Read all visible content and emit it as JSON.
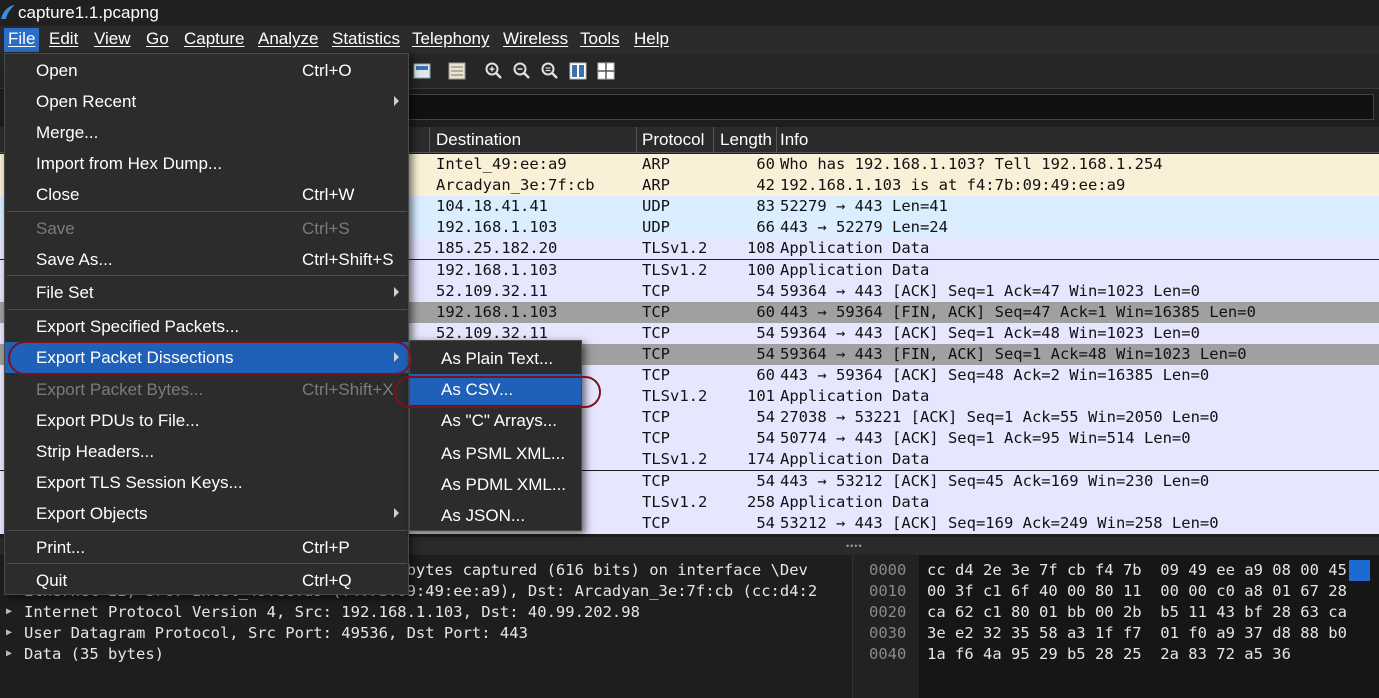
{
  "window": {
    "title": "capture1.1.pcapng"
  },
  "menubar": [
    {
      "label": "File"
    },
    {
      "label": "Edit"
    },
    {
      "label": "View"
    },
    {
      "label": "Go"
    },
    {
      "label": "Capture"
    },
    {
      "label": "Analyze"
    },
    {
      "label": "Statistics"
    },
    {
      "label": "Telephony"
    },
    {
      "label": "Wireless"
    },
    {
      "label": "Tools"
    },
    {
      "label": "Help"
    }
  ],
  "toolbar_icons": [
    "colorize-icon",
    "auto-scroll-icon",
    "zoom-in-icon",
    "zoom-out-icon",
    "zoom-reset-icon",
    "resize-columns-icon",
    "layout-icon"
  ],
  "packet_list": {
    "columns": [
      "Destination",
      "Protocol",
      "Length",
      "Info"
    ],
    "rows": [
      {
        "dst": "Intel_49:ee:a9",
        "proto": "ARP",
        "len": "60",
        "info": "Who has 192.168.1.103? Tell 192.168.1.254",
        "color": "#faf0d7"
      },
      {
        "dst": "Arcadyan_3e:7f:cb",
        "proto": "ARP",
        "len": "42",
        "info": "192.168.1.103 is at f4:7b:09:49:ee:a9",
        "color": "#faf0d7"
      },
      {
        "dst": "104.18.41.41",
        "proto": "UDP",
        "len": "83",
        "info": "52279 → 443 Len=41",
        "color": "#daeeff"
      },
      {
        "dst": "192.168.1.103",
        "proto": "UDP",
        "len": "66",
        "info": "443 → 52279 Len=24",
        "color": "#daeeff"
      },
      {
        "dst": "185.25.182.20",
        "proto": "TLSv1.2",
        "len": "108",
        "info": "Application Data",
        "color": "#e7e6ff"
      },
      {
        "dst": "192.168.1.103",
        "proto": "TLSv1.2",
        "len": "100",
        "info": "Application Data",
        "color": "#e7e6ff"
      },
      {
        "dst": "52.109.32.11",
        "proto": "TCP",
        "len": "54",
        "info": "59364 → 443 [ACK] Seq=1 Ack=47 Win=1023 Len=0",
        "color": "#e7e6ff"
      },
      {
        "dst": "192.168.1.103",
        "proto": "TCP",
        "len": "60",
        "info": "443 → 59364 [FIN, ACK] Seq=47 Ack=1 Win=16385 Len=0",
        "color": "#a0a0a0"
      },
      {
        "dst": "52.109.32.11",
        "proto": "TCP",
        "len": "54",
        "info": "59364 → 443 [ACK] Seq=1 Ack=48 Win=1023 Len=0",
        "color": "#e7e6ff"
      },
      {
        "dst": "",
        "proto": "TCP",
        "len": "54",
        "info": "59364 → 443 [FIN, ACK] Seq=1 Ack=48 Win=1023 Len=0",
        "color": "#a0a0a0"
      },
      {
        "dst": "",
        "proto": "TCP",
        "len": "60",
        "info": "443 → 59364 [ACK] Seq=48 Ack=2 Win=16385 Len=0",
        "color": "#e7e6ff"
      },
      {
        "dst": "",
        "proto": "TLSv1.2",
        "len": "101",
        "info": "Application Data",
        "color": "#e7e6ff"
      },
      {
        "dst": "",
        "proto": "TCP",
        "len": "54",
        "info": "27038 → 53221 [ACK] Seq=1 Ack=55 Win=2050 Len=0",
        "color": "#e7e6ff"
      },
      {
        "dst": "",
        "proto": "TCP",
        "len": "54",
        "info": "50774 → 443 [ACK] Seq=1 Ack=95 Win=514 Len=0",
        "color": "#e7e6ff"
      },
      {
        "dst": "",
        "proto": "TLSv1.2",
        "len": "174",
        "info": "Application Data",
        "color": "#e7e6ff"
      },
      {
        "dst": "",
        "proto": "TCP",
        "len": "54",
        "info": "443 → 53212 [ACK] Seq=45 Ack=169 Win=230 Len=0",
        "color": "#e7e6ff"
      },
      {
        "dst": "",
        "proto": "TLSv1.2",
        "len": "258",
        "info": "Application Data",
        "color": "#e7e6ff"
      },
      {
        "dst": "",
        "proto": "TCP",
        "len": "54",
        "info": "53212 → 443 [ACK] Seq=169 Ack=249 Win=258 Len=0",
        "color": "#e7e6ff"
      }
    ]
  },
  "details": {
    "rows": [
      {
        "text": "Frame 1: 77 bytes on wire (616 bits), 77 bytes captured (616 bits) on interface \\Dev"
      },
      {
        "text": "Ethernet II, Src: Intel_49:ee:a9 (f4:7b:09:49:ee:a9), Dst: Arcadyan_3e:7f:cb (cc:d4:2"
      },
      {
        "text": "Internet Protocol Version 4, Src: 192.168.1.103, Dst: 40.99.202.98"
      },
      {
        "text": "User Datagram Protocol, Src Port: 49536, Dst Port: 443"
      },
      {
        "text": "Data (35 bytes)"
      }
    ]
  },
  "hex": {
    "rows": [
      {
        "offset": "0000",
        "bytes": "cc d4 2e 3e 7f cb f4 7b  09 49 ee a9 08 00 45"
      },
      {
        "offset": "0010",
        "bytes": "00 3f c1 6f 40 00 80 11  00 00 c0 a8 01 67 28"
      },
      {
        "offset": "0020",
        "bytes": "ca 62 c1 80 01 bb 00 2b  b5 11 43 bf 28 63 ca"
      },
      {
        "offset": "0030",
        "bytes": "3e e2 32 35 58 a3 1f f7  01 f0 a9 37 d8 88 b0"
      },
      {
        "offset": "0040",
        "bytes": "1a f6 4a 95 29 b5 28 25  2a 83 72 a5 36"
      }
    ]
  },
  "file_menu": {
    "items": [
      {
        "label": "Open",
        "shortcut": "Ctrl+O"
      },
      {
        "label": "Open Recent",
        "shortcut": ""
      },
      {
        "label": "Merge...",
        "shortcut": ""
      },
      {
        "label": "Import from Hex Dump...",
        "shortcut": ""
      },
      {
        "label": "Close",
        "shortcut": "Ctrl+W"
      },
      {
        "label": "Save",
        "shortcut": "Ctrl+S"
      },
      {
        "label": "Save As...",
        "shortcut": "Ctrl+Shift+S"
      },
      {
        "label": "File Set",
        "shortcut": ""
      },
      {
        "label": "Export Specified Packets...",
        "shortcut": ""
      },
      {
        "label": "Export Packet Dissections",
        "shortcut": ""
      },
      {
        "label": "Export Packet Bytes...",
        "shortcut": "Ctrl+Shift+X"
      },
      {
        "label": "Export PDUs to File...",
        "shortcut": ""
      },
      {
        "label": "Strip Headers...",
        "shortcut": ""
      },
      {
        "label": "Export TLS Session Keys...",
        "shortcut": ""
      },
      {
        "label": "Export Objects",
        "shortcut": ""
      },
      {
        "label": "Print...",
        "shortcut": "Ctrl+P"
      },
      {
        "label": "Quit",
        "shortcut": "Ctrl+Q"
      }
    ]
  },
  "dissections_submenu": {
    "items": [
      {
        "label": "As Plain Text..."
      },
      {
        "label": "As CSV..."
      },
      {
        "label": "As \"C\" Arrays..."
      },
      {
        "label": "As PSML XML..."
      },
      {
        "label": "As PDML XML..."
      },
      {
        "label": "As JSON..."
      }
    ]
  },
  "colors": {
    "highlight": "#1f60b8",
    "annotation": "#7a1320",
    "menu_bg": "#2c2c2c"
  }
}
